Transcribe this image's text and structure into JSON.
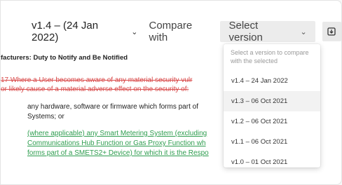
{
  "toolbar": {
    "current_version": "v1.4 – (24 Jan 2022)",
    "compare_label": "Compare with",
    "compare_placeholder": "Select version",
    "download_icon": "download-icon"
  },
  "document": {
    "heading": "facturers: Duty to Notify and Be Notified",
    "deleted_lines": [
      "17 Where a User becomes aware of any material security vulr",
      "or likely cause of a material adverse effect on the security of:"
    ],
    "plain_lines": [
      "any hardware, software or firmware which forms part of",
      "Systems; or"
    ],
    "inserted_lines": [
      "(where applicable) any Smart Metering System (excluding",
      "Communications Hub Function or Gas Proxy Function wh",
      "forms part of a SMETS2+ Device) for which it is the Respo"
    ]
  },
  "dropdown": {
    "hint": "Select a version to compare with the selected",
    "options": [
      "v1.4 – 24 Jan 2022",
      "v1.3 – 06 Oct 2021",
      "v1.2 – 06 Oct 2021",
      "v1.1 – 06 Oct 2021",
      "v1.0 – 01 Oct 2021"
    ],
    "highlighted_index": 1
  },
  "colors": {
    "deleted": "#d94b4b",
    "inserted": "#2e9d4f"
  }
}
